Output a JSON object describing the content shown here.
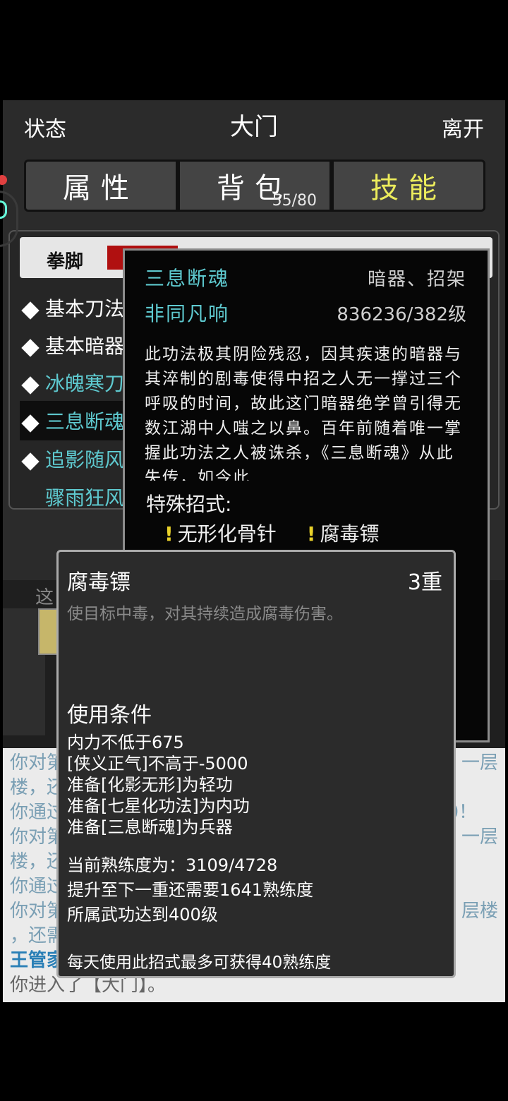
{
  "header": {
    "status": "状态",
    "title": "大门",
    "leave": "离开"
  },
  "tabs": [
    {
      "label": "属性"
    },
    {
      "label": "背包",
      "count": "55/80"
    },
    {
      "label": "技能"
    }
  ],
  "skills": {
    "subtabs": {
      "fist": "拳脚"
    },
    "list": [
      {
        "label": "基本刀法",
        "color": "white"
      },
      {
        "label": "基本暗器",
        "color": "white"
      },
      {
        "label": "冰魄寒刀",
        "color": "cyan"
      },
      {
        "label": "三息断魂",
        "color": "cyan",
        "selected": true
      },
      {
        "label": "追影随风",
        "color": "cyan"
      },
      {
        "label": "骤雨狂风",
        "color": "cyan"
      }
    ]
  },
  "skill_popup": {
    "name": "三息断魂",
    "types": "暗器、招架",
    "rank": "非同凡响",
    "level": "836236/382级",
    "description": "此功法极其阴险残忍，因其疾速的暗器与其淬制的剧毒使得中招之人无一撑过三个呼吸的时间，故此这门暗器绝学曾引得无数江湖中人嗤之以鼻。百年前随着唯一掌握此功法之人被诛杀，《三息断魂》从此失传，如今此",
    "special_header": "特殊招式:",
    "moves": [
      "无形化骨针",
      "腐毒镖"
    ]
  },
  "move_popup": {
    "name": "腐毒镖",
    "level": "3重",
    "description": "使目标中毒，对其持续造成腐毒伤害。",
    "conditions_header": "使用条件",
    "conditions": [
      "内力不低于675",
      "[侠义正气]不高于-5000",
      "准备[化影无形]为轻功",
      "准备[七星化功法]为内功",
      "准备[三息断魂]为兵器"
    ],
    "progress": [
      "当前熟练度为：3109/4728",
      "提升至下一重还需要1641熟练度",
      "所属武功达到400级"
    ],
    "daily": "每天使用此招式最多可获得40熟练度"
  },
  "log": {
    "lines": [
      {
        "left": "你对第",
        "right": "一层"
      },
      {
        "left": "楼，还",
        "right": ""
      },
      {
        "left": "你通过",
        "right": "0！"
      },
      {
        "left": "你对第",
        "right": "一层"
      },
      {
        "left": "楼，还",
        "right": ""
      },
      {
        "left": "你通过",
        "right": ""
      },
      {
        "left": "你对第",
        "right": "层楼"
      },
      {
        "left": "，还需",
        "right": ""
      }
    ],
    "npc": "王管家",
    "last": "你进入了【大门】。"
  },
  "scene": {
    "scrap_text": "这"
  }
}
